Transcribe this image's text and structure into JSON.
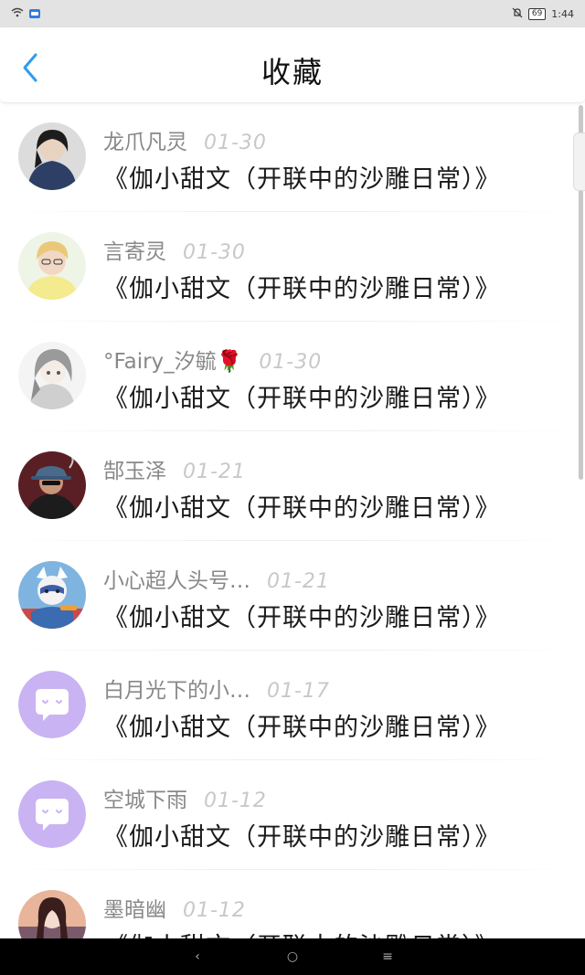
{
  "status_bar": {
    "battery": "69",
    "time": "1:44",
    "left_icons": [
      "wifi-icon",
      "app-badge-icon"
    ],
    "right_icons": [
      "mute-icon",
      "battery-icon"
    ]
  },
  "header": {
    "title": "收藏",
    "back_icon": "chevron-left-icon",
    "accent_color": "#2d9cf0"
  },
  "list": {
    "items": [
      {
        "username": "龙爪凡灵",
        "date": "01-30",
        "title": "《伽小甜文（开联中的沙雕日常）》",
        "avatar": "avatar-photo-dark"
      },
      {
        "username": "言寄灵",
        "date": "01-30",
        "title": "《伽小甜文（开联中的沙雕日常）》",
        "avatar": "avatar-photo-blond"
      },
      {
        "username": "°Fairy_汐毓",
        "date": "01-30",
        "title": "《伽小甜文（开联中的沙雕日常）》",
        "avatar": "avatar-anime-gray",
        "emoji": "🌹"
      },
      {
        "username": "郜玉泽",
        "date": "01-21",
        "title": "《伽小甜文（开联中的沙雕日常）》",
        "avatar": "avatar-photo-hat"
      },
      {
        "username": "小心超人头号…",
        "date": "01-21",
        "title": "《伽小甜文（开联中的沙雕日常）》",
        "avatar": "avatar-cartoon-fox"
      },
      {
        "username": "白月光下的小…",
        "date": "01-17",
        "title": "《伽小甜文（开联中的沙雕日常）》",
        "avatar": "avatar-default-chat"
      },
      {
        "username": "空城下雨",
        "date": "01-12",
        "title": "《伽小甜文（开联中的沙雕日常）》",
        "avatar": "avatar-default-chat"
      },
      {
        "username": "墨暗幽",
        "date": "01-12",
        "title": "《伽小甜文（开联中的沙雕日常）》",
        "avatar": "avatar-photo-girl"
      }
    ]
  },
  "nav_bar": {
    "back": "‹",
    "home": "○",
    "menu": "≡"
  },
  "colors": {
    "status_bar_bg": "#e3e3e3",
    "default_avatar_bg": "#c9b3f3",
    "username": "#888888",
    "date": "#c8c8c8",
    "title": "#1a1a1a"
  }
}
